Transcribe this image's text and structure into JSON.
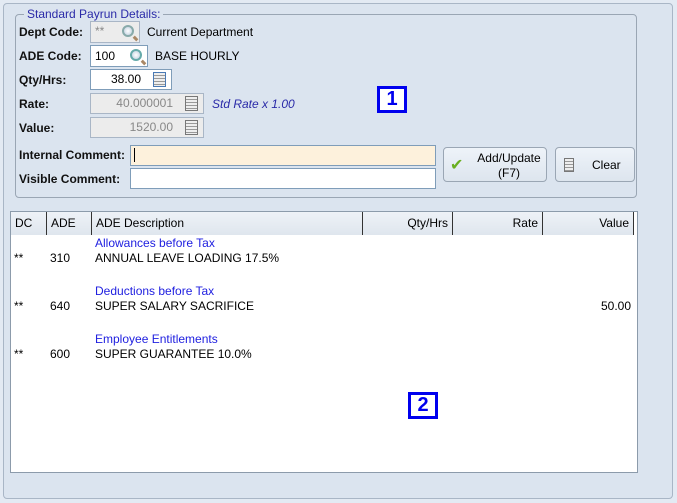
{
  "group_title": "Standard Payrun Details:",
  "fields": {
    "dept_code": {
      "label": "Dept Code:",
      "value": "**",
      "desc": "Current Department"
    },
    "ade_code": {
      "label": "ADE Code:",
      "value": "100",
      "desc": "BASE HOURLY"
    },
    "qty_hrs": {
      "label": "Qty/Hrs:",
      "value": "38.00"
    },
    "rate": {
      "label": "Rate:",
      "value": "40.000001",
      "note": "Std Rate x 1.00"
    },
    "value": {
      "label": "Value:",
      "value": "1520.00"
    },
    "internal_comment": {
      "label": "Internal Comment:",
      "value": ""
    },
    "visible_comment": {
      "label": "Visible Comment:",
      "value": ""
    }
  },
  "buttons": {
    "add_update": "Add/Update",
    "add_update_key": "(F7)",
    "clear": "Clear"
  },
  "markers": [
    "1",
    "2"
  ],
  "table": {
    "columns": [
      "DC",
      "ADE",
      "ADE Description",
      "Qty/Hrs",
      "Rate",
      "Value"
    ],
    "groups": [
      {
        "heading": "Allowances before Tax",
        "rows": [
          {
            "dc": "**",
            "ade": "310",
            "desc": "ANNUAL LEAVE LOADING 17.5%",
            "qty": "",
            "rate": "",
            "value": ""
          }
        ]
      },
      {
        "heading": "Deductions before Tax",
        "rows": [
          {
            "dc": "**",
            "ade": "640",
            "desc": "SUPER SALARY SACRIFICE",
            "qty": "",
            "rate": "",
            "value": "50.00"
          }
        ]
      },
      {
        "heading": "Employee Entitlements",
        "rows": [
          {
            "dc": "**",
            "ade": "600",
            "desc": "SUPER GUARANTEE 10.0%",
            "qty": "",
            "rate": "",
            "value": ""
          }
        ]
      }
    ]
  }
}
